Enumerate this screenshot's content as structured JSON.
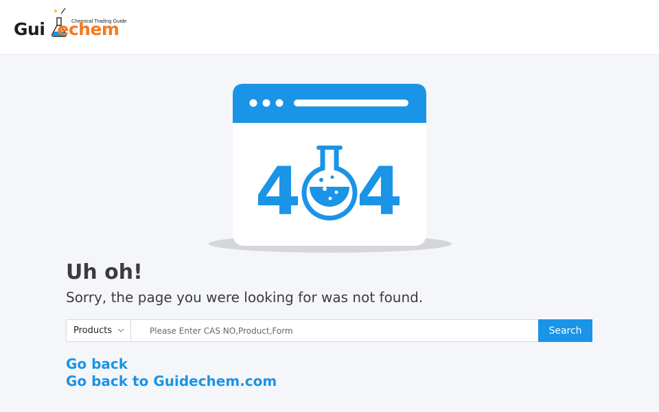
{
  "header": {
    "logo": {
      "tagline": "Chemical Trading Guide",
      "wordmark_left": "Gui",
      "wordmark_right": "echem",
      "brand_dark": "#1d1d1d",
      "brand_orange": "#f47a20"
    }
  },
  "illustration": {
    "code_left": "4",
    "code_right": "4",
    "accent": "#1a94e6"
  },
  "main": {
    "title": "Uh oh!",
    "subtitle": "Sorry, the page you were looking for was not found."
  },
  "search": {
    "category": "Products",
    "placeholder": "Please Enter CAS NO,Product,Form",
    "value": "",
    "button_label": "Search"
  },
  "links": {
    "go_back": "Go back",
    "go_home": "Go back to Guidechem.com"
  }
}
